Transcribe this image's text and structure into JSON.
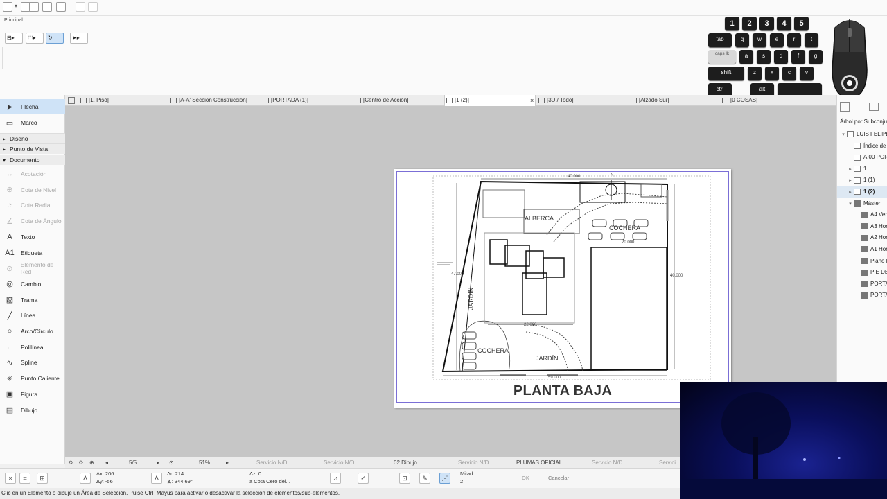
{
  "ribbon": {
    "principal_label": "Principal"
  },
  "left_panel": {
    "tools_top": [
      {
        "name": "tool-flecha",
        "label": "Flecha",
        "icon": "arrow-pointer-icon",
        "selected": true
      },
      {
        "name": "tool-marco",
        "label": "Marco",
        "icon": "marquee-icon"
      }
    ],
    "groups": {
      "diseno": "Diseño",
      "punto_vista": "Punto de Vista",
      "documento": "Documento"
    },
    "doc_tools": [
      {
        "name": "tool-acotacion",
        "label": "Acotación",
        "icon": "dimension-icon",
        "dim": true
      },
      {
        "name": "tool-cota-nivel",
        "label": "Cota de Nivel",
        "icon": "level-dimension-icon",
        "dim": true
      },
      {
        "name": "tool-cota-radial",
        "label": "Cota Radial",
        "icon": "radial-dimension-icon",
        "dim": true
      },
      {
        "name": "tool-cota-angulo",
        "label": "Cota de Ángulo",
        "icon": "angle-dimension-icon",
        "dim": true
      },
      {
        "name": "tool-texto",
        "label": "Texto",
        "icon": "text-icon"
      },
      {
        "name": "tool-etiqueta",
        "label": "Etiqueta",
        "icon": "label-icon"
      },
      {
        "name": "tool-elemento-red",
        "label": "Elemento de Red",
        "icon": "grid-element-icon",
        "dim": true
      },
      {
        "name": "tool-cambio",
        "label": "Cambio",
        "icon": "change-icon"
      },
      {
        "name": "tool-trama",
        "label": "Trama",
        "icon": "hatch-icon"
      },
      {
        "name": "tool-linea",
        "label": "Línea",
        "icon": "line-icon"
      },
      {
        "name": "tool-arco",
        "label": "Arco/Círculo",
        "icon": "arc-icon"
      },
      {
        "name": "tool-polilinea",
        "label": "Polilínea",
        "icon": "polyline-icon"
      },
      {
        "name": "tool-spline",
        "label": "Spline",
        "icon": "spline-icon"
      },
      {
        "name": "tool-punto-caliente",
        "label": "Punto Caliente",
        "icon": "hotspot-icon"
      },
      {
        "name": "tool-figura",
        "label": "Figura",
        "icon": "figure-icon"
      },
      {
        "name": "tool-dibujo",
        "label": "Dibujo",
        "icon": "drawing-icon"
      }
    ]
  },
  "tabs": [
    {
      "label": "[1. Piso]"
    },
    {
      "label": "[A-A' Sección Construcción]"
    },
    {
      "label": "[PORTADA (1)]"
    },
    {
      "label": "[Centro de Acción]"
    },
    {
      "label": "[1 (2)]",
      "active": true
    },
    {
      "label": "[3D / Todo]"
    },
    {
      "label": "[Alzado Sur]"
    },
    {
      "label": "[0 COSAS]"
    }
  ],
  "drawing": {
    "title": "PLANTA BAJA",
    "labels": {
      "alberca": "ALBERCA",
      "cochera_top": "COCHERA",
      "jardin_left": "JARDIN",
      "cochera_bottom": "COCHERA",
      "jardin_bottom": "JARDÍN",
      "north": "N"
    },
    "dims": {
      "top": "40.000",
      "right_mid": "20.000",
      "right": "40.000",
      "left": "47.000",
      "inner": "22.000",
      "bottom": "59.000"
    }
  },
  "right_panel": {
    "header": "Árbol por Subconjuntos",
    "items": [
      {
        "label": "LUIS FELIPE",
        "level": 0,
        "arrow": "▾",
        "dark": false
      },
      {
        "label": "Índice de",
        "level": 1,
        "arrow": "",
        "dark": false
      },
      {
        "label": "A.00 PORT",
        "level": 1,
        "arrow": "",
        "dark": false
      },
      {
        "label": "1",
        "level": 1,
        "arrow": "▸",
        "dark": false
      },
      {
        "label": "1 (1)",
        "level": 1,
        "arrow": "▸",
        "dark": false
      },
      {
        "label": "1 (2)",
        "level": 1,
        "arrow": "▸",
        "dark": false,
        "selected": true
      },
      {
        "label": "Máster",
        "level": 1,
        "arrow": "▾",
        "dark": true
      },
      {
        "label": "A4 Verti",
        "level": 2,
        "arrow": "",
        "dark": true
      },
      {
        "label": "A3 Horiz",
        "level": 2,
        "arrow": "",
        "dark": true
      },
      {
        "label": "A2 Horiz",
        "level": 2,
        "arrow": "",
        "dark": true
      },
      {
        "label": "A1 Horiz",
        "level": 2,
        "arrow": "",
        "dark": true
      },
      {
        "label": "Plano M",
        "level": 2,
        "arrow": "",
        "dark": true
      },
      {
        "label": "PIE DE P",
        "level": 2,
        "arrow": "",
        "dark": true
      },
      {
        "label": "PORTAD",
        "level": 2,
        "arrow": "",
        "dark": true
      },
      {
        "label": "PORTAD",
        "level": 2,
        "arrow": "",
        "dark": true
      }
    ]
  },
  "bottom_bar1": {
    "pages": "5/5",
    "zoom": "51%",
    "servicio1": "Servicio N/D",
    "servicio2": "Servicio N/D",
    "dibujo": "02 Dibujo",
    "servicio3": "Servicio N/D",
    "plumas": "PLUMAS OFICIAL...",
    "servicio4": "Servicio N/D",
    "servicio5": "Servici"
  },
  "bottom_bar2": {
    "dx": "Δx: 206",
    "dy": "Δy: -56",
    "ar": "Δr: 214",
    "aa": "∡: 344.69°",
    "az": "Δz: 0",
    "cota": "a Cota Cero del...",
    "mitad": "Mitad",
    "mitad_val": "2",
    "ok": "OK",
    "cancel": "Cancelar"
  },
  "status": "Clic en un Elemento o dibuje un Área de Selección. Pulse Ctrl+Mayús para activar o desactivar la selección de elementos/sub-elementos.",
  "keyboard_overlay": {
    "numbers": [
      "1",
      "2",
      "3",
      "4",
      "5"
    ],
    "row1": [
      "tab",
      "q",
      "w",
      "e",
      "r",
      "t"
    ],
    "row2": [
      "caps lk",
      "a",
      "s",
      "d",
      "f",
      "g"
    ],
    "row3": [
      "shift",
      "z",
      "x",
      "c",
      "v"
    ],
    "row4": [
      "ctrl",
      "alt",
      ""
    ]
  }
}
